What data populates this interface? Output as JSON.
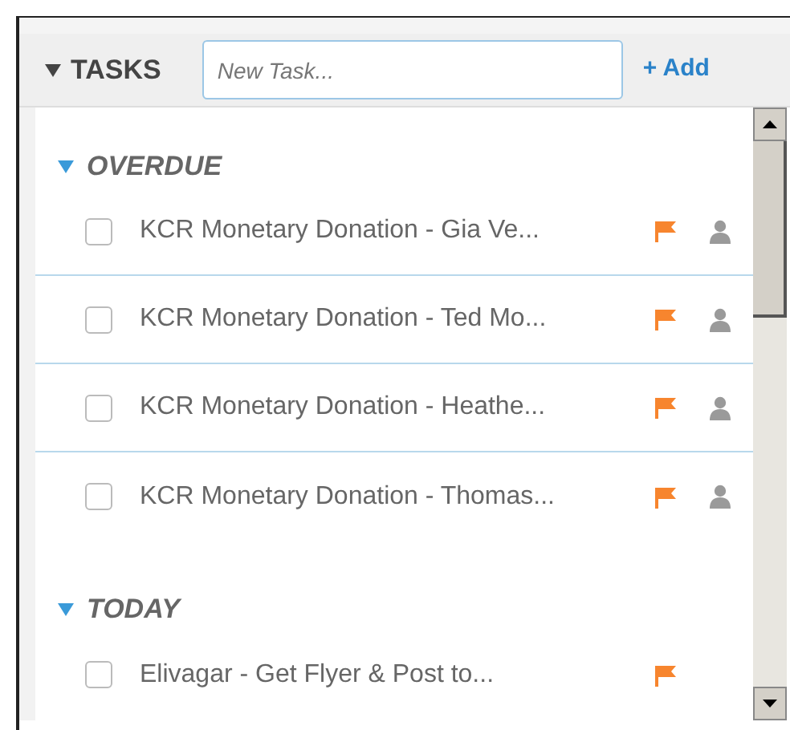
{
  "panel": {
    "title": "TASKS",
    "expanded": true,
    "new_task": {
      "placeholder": "New Task..."
    },
    "add_button": "+ Add"
  },
  "groups": [
    {
      "label": "OVERDUE",
      "expanded": true,
      "tasks": [
        {
          "title": "KCR Monetary Donation - Gia Ve...",
          "checked": false,
          "flagged": true,
          "assigned": true
        },
        {
          "title": "KCR Monetary Donation - Ted Mo...",
          "checked": false,
          "flagged": true,
          "assigned": true
        },
        {
          "title": "KCR Monetary Donation - Heathe...",
          "checked": false,
          "flagged": true,
          "assigned": true
        },
        {
          "title": "KCR Monetary Donation - Thomas...",
          "checked": false,
          "flagged": true,
          "assigned": true
        }
      ]
    },
    {
      "label": "TODAY",
      "expanded": true,
      "tasks": [
        {
          "title": "Elivagar - Get Flyer & Post to...",
          "checked": false,
          "flagged": true,
          "assigned": false
        }
      ]
    }
  ]
}
